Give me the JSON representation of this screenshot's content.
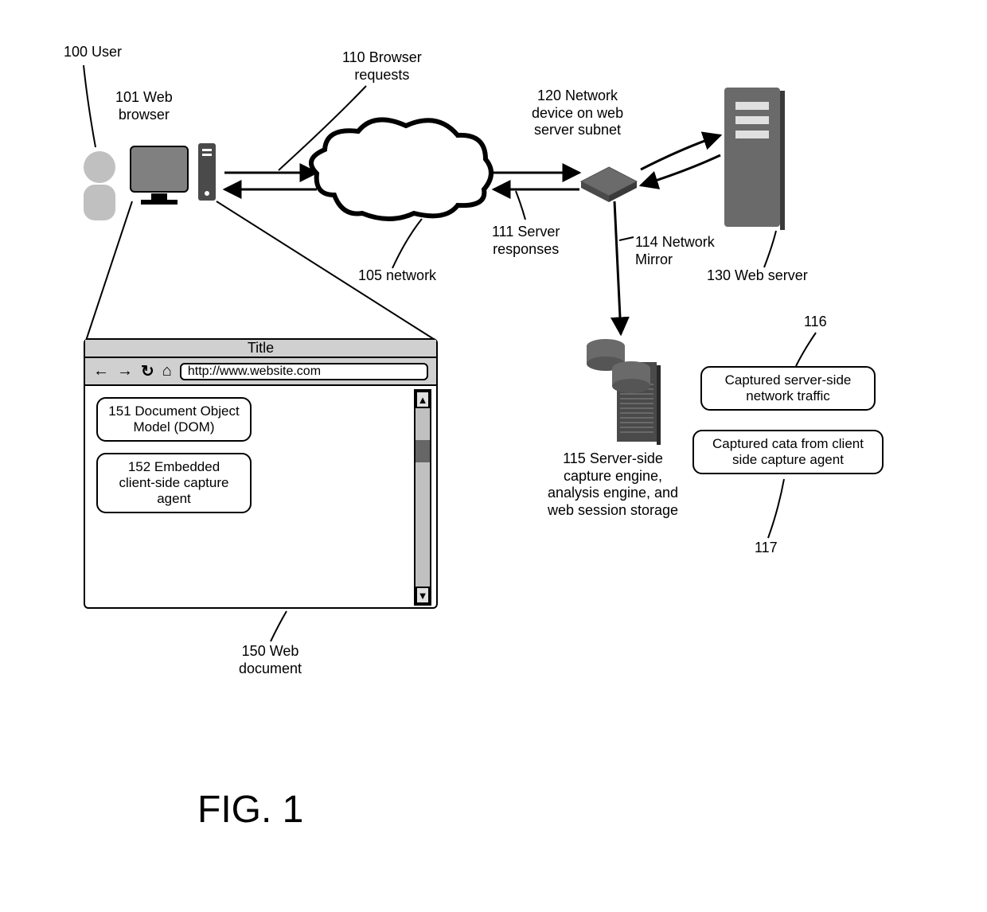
{
  "labels": {
    "user": "100 User",
    "web_browser": "101 Web\nbrowser",
    "browser_requests": "110 Browser\nrequests",
    "network_device": "120 Network\ndevice on web\nserver subnet",
    "server_responses": "111 Server\nresponses",
    "network_mirror": "114 Network\nMirror",
    "network": "105 network",
    "web_server": "130 Web server",
    "server_side_engine": "115 Server-side\ncapture engine,\nanalysis engine, and\nweb session storage",
    "captured_traffic": "Captured server-side\nnetwork traffic",
    "captured_client": "Captured cata from client\nside capture agent",
    "num_116": "116",
    "num_117": "117",
    "web_document": "150 Web\ndocument",
    "dom": "151 Document Object\nModel (DOM)",
    "agent": "152 Embedded\nclient-side capture\nagent"
  },
  "browser": {
    "title": "Title",
    "url": "http://www.website.com"
  },
  "figure": "FIG. 1"
}
